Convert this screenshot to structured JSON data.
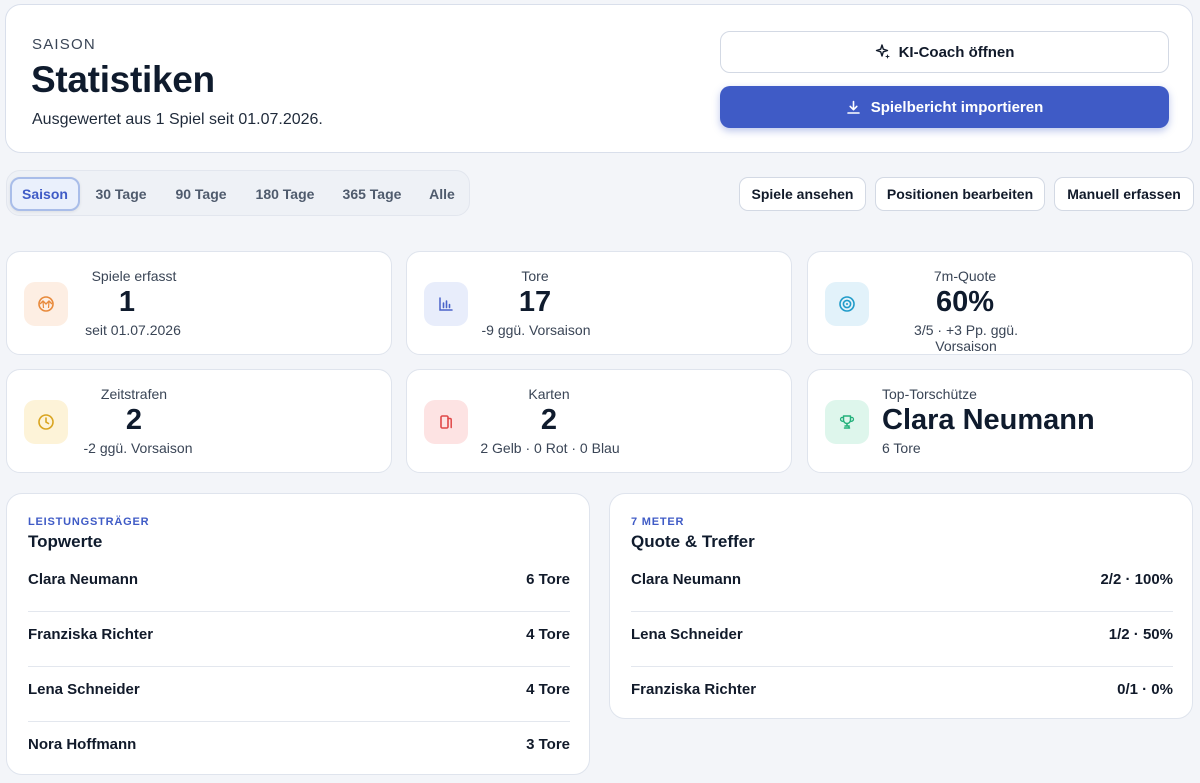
{
  "header": {
    "eyebrow": "SAISON",
    "title": "Statistiken",
    "subtitle": "Ausgewertet aus 1 Spiel seit 01.07.2026.",
    "coach_button": "KI-Coach öffnen",
    "import_button": "Spielbericht importieren"
  },
  "tabs": [
    {
      "label": "Saison",
      "active": true
    },
    {
      "label": "30 Tage",
      "active": false
    },
    {
      "label": "90 Tage",
      "active": false
    },
    {
      "label": "180 Tage",
      "active": false
    },
    {
      "label": "365 Tage",
      "active": false
    },
    {
      "label": "Alle",
      "active": false
    }
  ],
  "actions": {
    "view_games": "Spiele ansehen",
    "edit_positions": "Positionen bearbeiten",
    "manual_entry": "Manuell erfassen"
  },
  "stats": [
    {
      "label": "Spiele erfasst",
      "value": "1",
      "sub": "seit 01.07.2026",
      "icon": "ball-icon",
      "color": "#e8893a",
      "bg": "#fdeee3"
    },
    {
      "label": "Tore",
      "value": "17",
      "sub": "-9 ggü. Vorsaison",
      "icon": "bar-chart-icon",
      "color": "#4a63c9",
      "bg": "#e8edfb"
    },
    {
      "label": "7m-Quote",
      "value": "60%",
      "sub": "3/5 · +3 Pp. ggü. Vorsaison",
      "icon": "target-icon",
      "color": "#1f9bc9",
      "bg": "#e2f2fa"
    },
    {
      "label": "Zeitstrafen",
      "value": "2",
      "sub": "-2 ggü. Vorsaison",
      "icon": "clock-icon",
      "color": "#d9a41f",
      "bg": "#fdf3d8"
    },
    {
      "label": "Karten",
      "value": "2",
      "sub": "2 Gelb · 0 Rot · 0 Blau",
      "icon": "cards-icon",
      "color": "#e04848",
      "bg": "#fde3e3"
    },
    {
      "label": "Top-Torschütze",
      "value": "Clara Neumann",
      "sub": "6 Tore",
      "icon": "trophy-icon",
      "color": "#22b07a",
      "bg": "#def6ec"
    }
  ],
  "top_performers": {
    "eyebrow": "LEISTUNGSTRÄGER",
    "title": "Topwerte",
    "rows": [
      {
        "name": "Clara Neumann",
        "value": "6 Tore"
      },
      {
        "name": "Franziska Richter",
        "value": "4 Tore"
      },
      {
        "name": "Lena Schneider",
        "value": "4 Tore"
      },
      {
        "name": "Nora Hoffmann",
        "value": "3 Tore"
      }
    ]
  },
  "seven_meter": {
    "eyebrow": "7 METER",
    "title": "Quote & Treffer",
    "rows": [
      {
        "name": "Clara Neumann",
        "value": "2/2 · 100%"
      },
      {
        "name": "Lena Schneider",
        "value": "1/2 · 50%"
      },
      {
        "name": "Franziska Richter",
        "value": "0/1 · 0%"
      }
    ]
  }
}
